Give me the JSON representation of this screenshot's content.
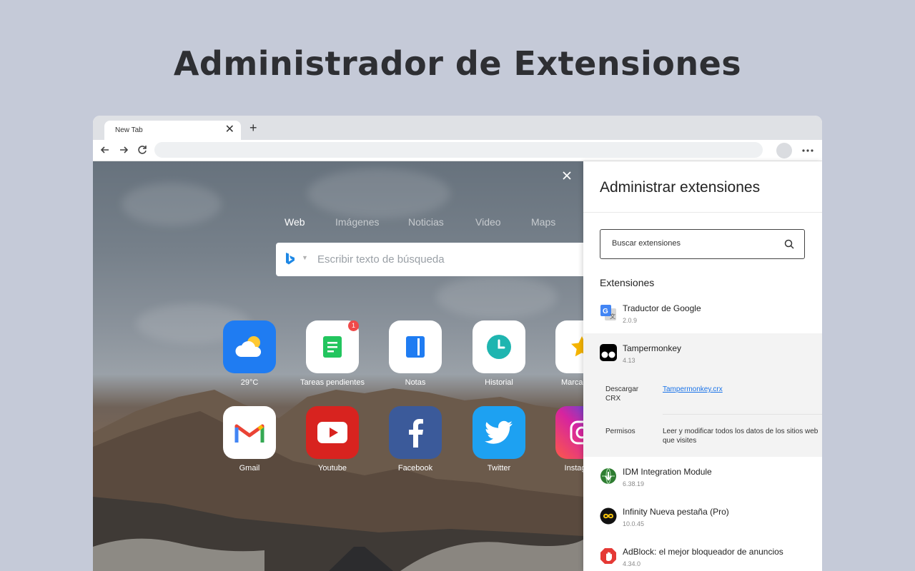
{
  "headline": "Administrador de Extensiones",
  "browser": {
    "tab_title": "New Tab",
    "tab_close": "✕",
    "new_tab": "+"
  },
  "newtab": {
    "close": "✕",
    "search_tabs": [
      "Web",
      "Imágenes",
      "Noticias",
      "Video",
      "Maps"
    ],
    "search_placeholder": "Escribir texto de búsqueda",
    "tiles_row1": [
      {
        "label": "29°C",
        "icon": "weather-icon",
        "bg": "#1f7cf2"
      },
      {
        "label": "Tareas pendientes",
        "icon": "tasks-icon",
        "bg": "#ffffff",
        "badge": "1"
      },
      {
        "label": "Notas",
        "icon": "notes-icon",
        "bg": "#ffffff"
      },
      {
        "label": "Historial",
        "icon": "history-icon",
        "bg": "#ffffff"
      },
      {
        "label": "Marcadores",
        "icon": "bookmarks-icon",
        "bg": "#ffffff"
      }
    ],
    "tiles_row2": [
      {
        "label": "Gmail",
        "icon": "gmail-icon",
        "bg": "#ffffff"
      },
      {
        "label": "Youtube",
        "icon": "youtube-icon",
        "bg": "#d8231f"
      },
      {
        "label": "Facebook",
        "icon": "facebook-icon",
        "bg": "#3b5a9a"
      },
      {
        "label": "Twitter",
        "icon": "twitter-icon",
        "bg": "#1da1f2"
      },
      {
        "label": "Instagram",
        "icon": "instagram-icon",
        "bg": "#e1306c"
      }
    ]
  },
  "panel": {
    "title": "Administrar extensiones",
    "search_placeholder": "Buscar extensiones",
    "section": "Extensiones",
    "extensions": [
      {
        "name": "Traductor de Google",
        "version": "2.0.9",
        "icon": "google-translate-icon"
      },
      {
        "name": "Tampermonkey",
        "version": "4.13",
        "icon": "tampermonkey-icon"
      },
      {
        "name": "IDM Integration Module",
        "version": "6.38.19",
        "icon": "idm-icon"
      },
      {
        "name": "Infinity Nueva pestaña (Pro)",
        "version": "10.0.45",
        "icon": "infinity-icon"
      },
      {
        "name": "AdBlock: el mejor bloqueador de anuncios",
        "version": "4.34.0",
        "icon": "adblock-icon"
      }
    ],
    "detail": {
      "download_label": "Descargar CRX",
      "download_value": "Tampermonkey.crx",
      "permissions_label": "Permisos",
      "permissions_value": "Leer y modificar todos los datos de los sitios web que visites"
    }
  },
  "colors": {
    "page_bg": "#c5cad8",
    "link": "#1a73e8",
    "badge": "#f04a4a"
  }
}
